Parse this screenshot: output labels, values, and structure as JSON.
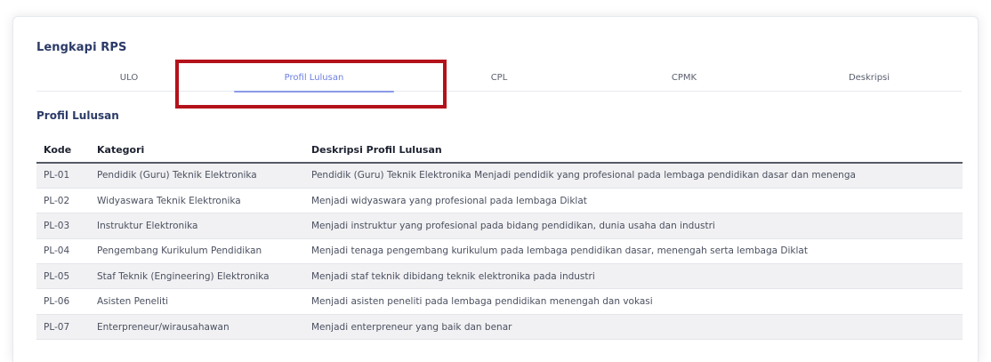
{
  "card": {
    "title": "Lengkapi RPS"
  },
  "tabs": [
    {
      "label": "ULO",
      "active": false
    },
    {
      "label": "Profil Lulusan",
      "active": true
    },
    {
      "label": "CPL",
      "active": false
    },
    {
      "label": "CPMK",
      "active": false
    },
    {
      "label": "Deskripsi",
      "active": false
    }
  ],
  "section": {
    "title": "Profil Lulusan"
  },
  "table": {
    "headers": [
      "Kode",
      "Kategori",
      "Deskripsi Profil Lulusan"
    ],
    "rows": [
      [
        "PL-01",
        "Pendidik (Guru) Teknik Elektronika",
        "Pendidik (Guru) Teknik Elektronika Menjadi pendidik yang profesional pada lembaga pendidikan dasar dan menenga"
      ],
      [
        "PL-02",
        "Widyaswara Teknik Elektronika",
        "Menjadi widyaswara yang profesional pada lembaga Diklat"
      ],
      [
        "PL-03",
        "Instruktur Elektronika",
        "Menjadi instruktur yang profesional pada bidang pendidikan, dunia usaha dan industri"
      ],
      [
        "PL-04",
        "Pengembang Kurikulum Pendidikan",
        "Menjadi tenaga pengembang kurikulum pada lembaga pendidikan dasar, menengah serta lembaga Diklat"
      ],
      [
        "PL-05",
        "Staf Teknik (Engineering) Elektronika",
        "Menjadi staf teknik dibidang teknik elektronika pada industri"
      ],
      [
        "PL-06",
        "Asisten Peneliti",
        "Menjadi asisten peneliti pada lembaga pendidikan menengah dan vokasi"
      ],
      [
        "PL-07",
        "Enterpreneur/wirausahawan",
        "Menjadi enterpreneur yang baik dan benar"
      ]
    ]
  },
  "colors": {
    "accent": "#6c7ee3",
    "heading": "#2b3a67",
    "highlight_box": "#b4121b"
  }
}
